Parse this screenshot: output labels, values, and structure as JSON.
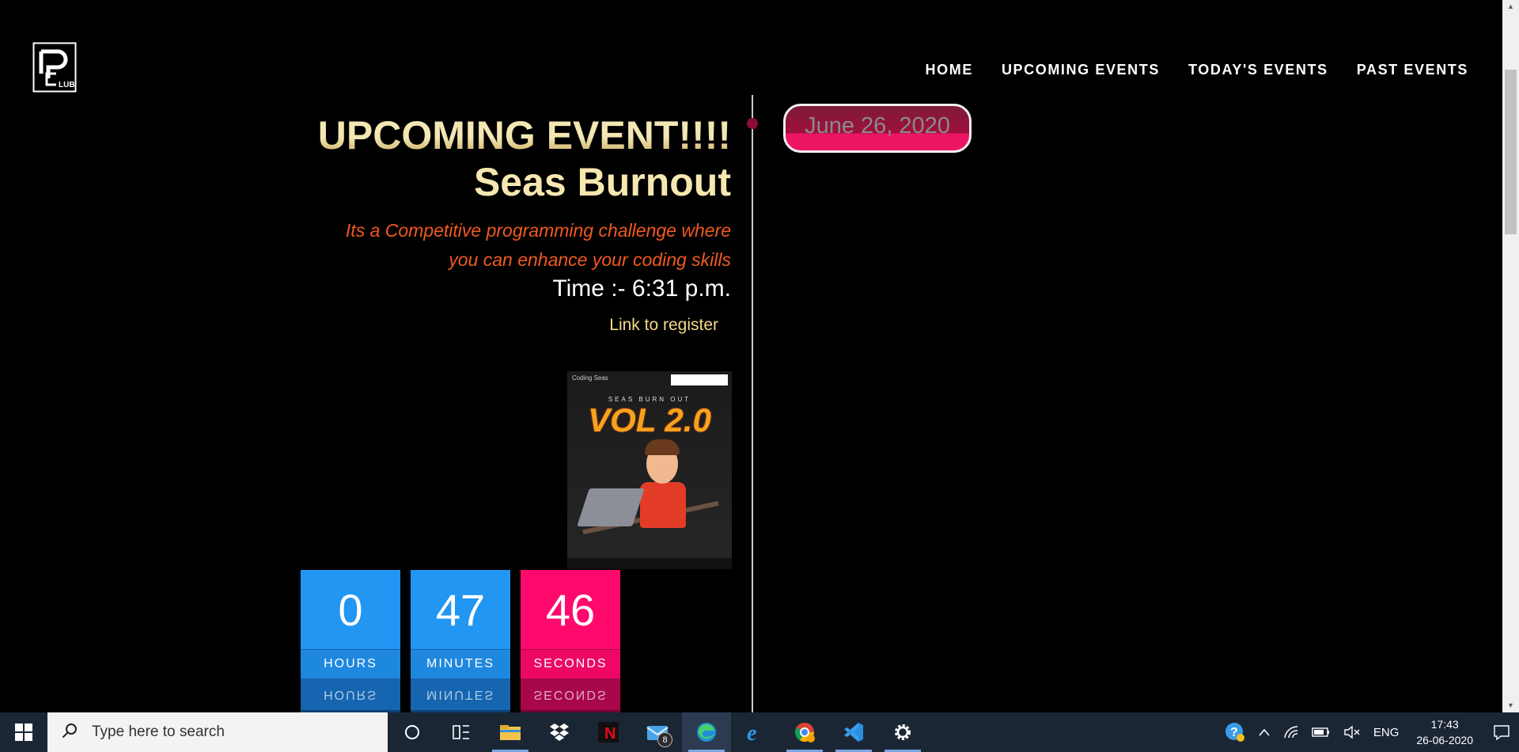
{
  "logo": {
    "text": "LUB"
  },
  "nav": {
    "items": [
      {
        "label": "HOME"
      },
      {
        "label": "UPCOMING EVENTS"
      },
      {
        "label": "TODAY'S EVENTS"
      },
      {
        "label": "PAST EVENTS"
      }
    ]
  },
  "event": {
    "headline": "UPCOMING EVENT!!!!",
    "title": "Seas Burnout",
    "description_line1": "Its a Competitive programming challenge where",
    "description_line2": "you can enhance your coding skills",
    "time": "Time :- 6:31 p.m.",
    "register_link": "Link to register",
    "date": "June 26, 2020"
  },
  "poster": {
    "org": "Coding Seas",
    "subtitle": "SEAS BURN OUT",
    "volume": "VOL 2.0"
  },
  "countdown": [
    {
      "value": "0",
      "label": "HOURS",
      "color": "blue"
    },
    {
      "value": "47",
      "label": "MINUTES",
      "color": "blue"
    },
    {
      "value": "46",
      "label": "SECONDS",
      "color": "pink"
    }
  ],
  "taskbar": {
    "search_placeholder": "Type here to search",
    "mail_badge": "8",
    "language": "ENG",
    "time": "17:43",
    "date": "26-06-2020"
  },
  "colors": {
    "background": "#000000",
    "headline": "#f3e7b3",
    "description": "#f05a1d",
    "register": "#f3d98c",
    "countdown_blue": "#2196f3",
    "countdown_pink": "#ff0a6c",
    "date_pill": "#ec1563",
    "taskbar": "#1b2635"
  }
}
